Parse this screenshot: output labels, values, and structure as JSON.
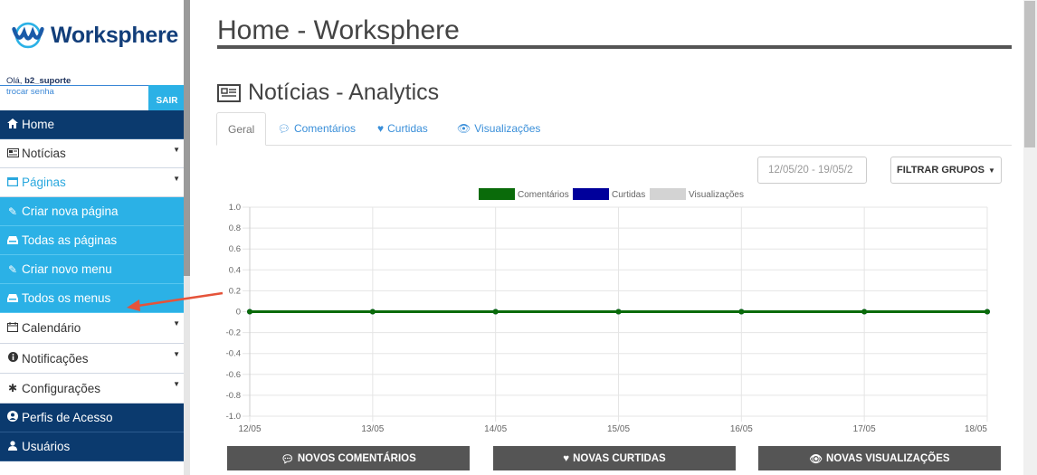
{
  "sidebar": {
    "logo_text": "Worksphere",
    "greeting_prefix": "Olá,",
    "username": "b2_suporte",
    "change_password": "trocar senha",
    "logout": "SAIR",
    "items": [
      {
        "label": "Home",
        "icon": "home-icon"
      },
      {
        "label": "Notícias",
        "icon": "newspaper-icon"
      },
      {
        "label": "Páginas",
        "icon": "window-icon"
      },
      {
        "label": "Criar nova página",
        "icon": "pencil-icon"
      },
      {
        "label": "Todas as páginas",
        "icon": "inbox-icon"
      },
      {
        "label": "Criar novo menu",
        "icon": "pencil-icon"
      },
      {
        "label": "Todos os menus",
        "icon": "inbox-icon"
      },
      {
        "label": "Calendário",
        "icon": "calendar-icon"
      },
      {
        "label": "Notificações",
        "icon": "info-icon"
      },
      {
        "label": "Configurações",
        "icon": "gear-icon"
      },
      {
        "label": "Perfis de Acesso",
        "icon": "user-circle-icon"
      },
      {
        "label": "Usuários",
        "icon": "user-icon"
      }
    ]
  },
  "header": {
    "title": "Home - Worksphere"
  },
  "section": {
    "title": "Notícias - Analytics",
    "icon": "newspaper-icon"
  },
  "tabs": [
    {
      "label": "Geral"
    },
    {
      "label": "Comentários",
      "icon": "comment-icon"
    },
    {
      "label": "Curtidas",
      "icon": "heart-icon"
    },
    {
      "label": "Visualizações",
      "icon": "eye-icon"
    }
  ],
  "filters": {
    "date_range": "12/05/20 - 19/05/2",
    "group_button": "FILTRAR GRUPOS"
  },
  "colors": {
    "dark_nav": "#0b3a6e",
    "light_nav": "#2bb1e6",
    "comentarios": "#0a6b0a",
    "curtidas": "#00009b",
    "visualizacoes": "#d3d3d3"
  },
  "chart_data": {
    "type": "line",
    "x": [
      "12/05",
      "13/05",
      "14/05",
      "15/05",
      "16/05",
      "17/05",
      "18/05"
    ],
    "yticks": [
      "1.0",
      "0.8",
      "0.6",
      "0.4",
      "0.2",
      "0",
      "-0.2",
      "-0.4",
      "-0.6",
      "-0.8",
      "-1.0"
    ],
    "ylim": [
      -1.0,
      1.0
    ],
    "legend_position": "top",
    "grid": true,
    "series": [
      {
        "name": "Comentários",
        "color": "#0a6b0a",
        "values": [
          0,
          0,
          0,
          0,
          0,
          0,
          0
        ]
      },
      {
        "name": "Curtidas",
        "color": "#00009b",
        "values": [
          0,
          0,
          0,
          0,
          0,
          0,
          0
        ]
      },
      {
        "name": "Visualizações",
        "color": "#d3d3d3",
        "values": [
          0,
          0,
          0,
          0,
          0,
          0,
          0
        ]
      }
    ]
  },
  "bottom_buttons": [
    {
      "label": "NOVOS COMENTÁRIOS",
      "icon": "comment-icon"
    },
    {
      "label": "NOVAS CURTIDAS",
      "icon": "heart-icon"
    },
    {
      "label": "NOVAS VISUALIZAÇÕES",
      "icon": "eye-icon"
    }
  ]
}
